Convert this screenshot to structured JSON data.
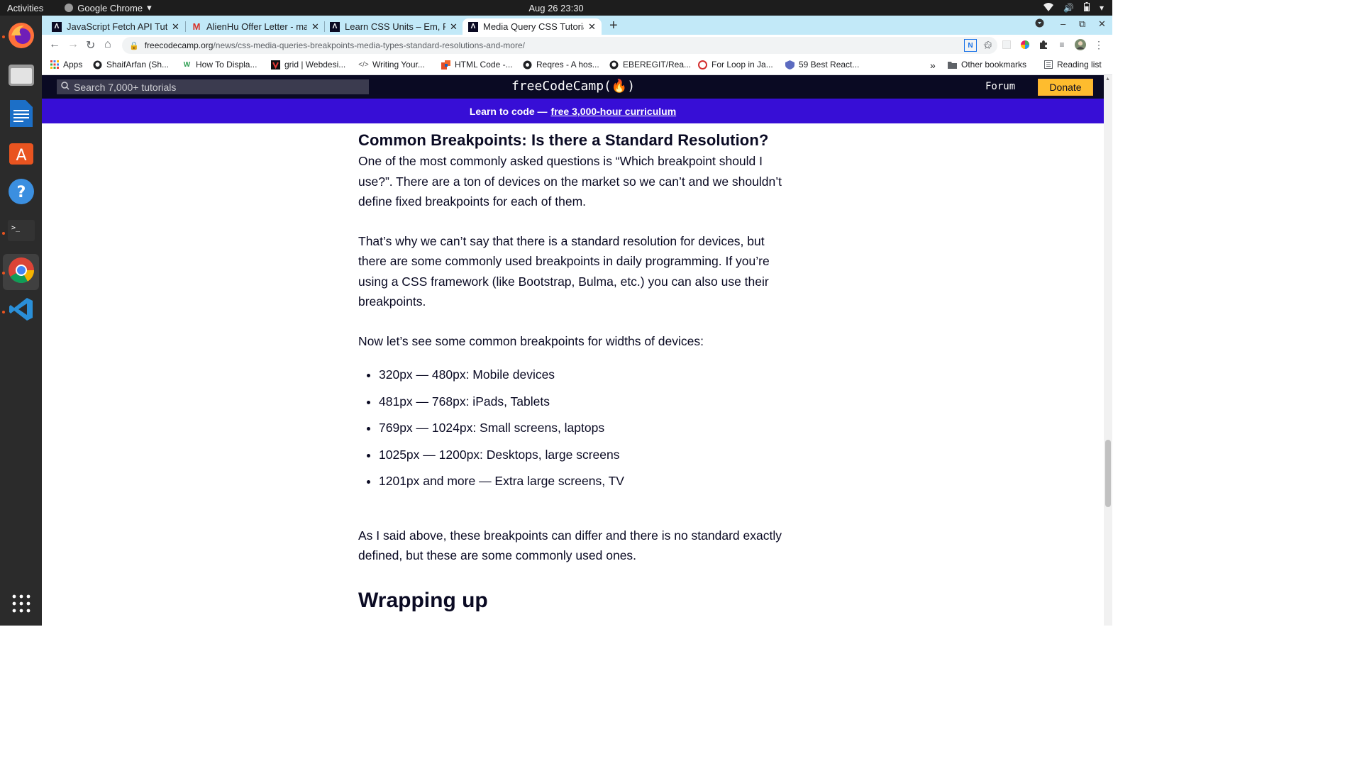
{
  "system": {
    "activities": "Activities",
    "app_name": "Google Chrome",
    "clock": "Aug 26  23:30"
  },
  "tabs": [
    {
      "title": "JavaScript Fetch API Tuto",
      "favicon": "freecodecamp-icon"
    },
    {
      "title": "AlienHu Offer Letter - ma",
      "favicon": "gmail-icon"
    },
    {
      "title": "Learn CSS Units – Em, Rem",
      "favicon": "freecodecamp-icon"
    },
    {
      "title": "Media Query CSS Tutorial",
      "favicon": "freecodecamp-icon",
      "active": true
    }
  ],
  "address": {
    "domain": "freecodecamp.org",
    "path": "/news/css-media-queries-breakpoints-media-types-standard-resolutions-and-more/"
  },
  "bookmarks": [
    {
      "label": "Apps"
    },
    {
      "label": "ShaifArfan (Sh..."
    },
    {
      "label": "How To Displa..."
    },
    {
      "label": "grid | Webdesi..."
    },
    {
      "label": "Writing Your..."
    },
    {
      "label": "HTML Code -..."
    },
    {
      "label": "Reqres - A hos..."
    },
    {
      "label": "EBEREGIT/Rea..."
    },
    {
      "label": "For Loop in Ja..."
    },
    {
      "label": "59 Best React..."
    }
  ],
  "bookmarks_overflow": "»",
  "other_bookmarks": "Other bookmarks",
  "reading_list": "Reading list",
  "fcc": {
    "search_placeholder": "Search 7,000+ tutorials",
    "logo": "freeCodeCamp(🔥)",
    "forum": "Forum",
    "donate": "Donate",
    "banner_text": "Learn to code —",
    "banner_link": "free 3,000-hour curriculum"
  },
  "article": {
    "heading": "Common Breakpoints: Is there a Standard Resolution?",
    "p1": "One of the most commonly asked questions is “Which breakpoint should I use?”. There are a ton of devices on the market so we can’t and we shouldn’t define fixed breakpoints for each of them.",
    "p2": "That’s why we can’t say that there is a standard resolution for devices, but there are some commonly used breakpoints in daily programming. If you’re using a CSS framework (like Bootstrap, Bulma, etc.) you can also use their breakpoints.",
    "p3": "Now let’s see some common breakpoints for widths of devices:",
    "list": [
      "320px — 480px: Mobile devices",
      "481px — 768px: iPads, Tablets",
      "769px — 1024px: Small screens, laptops",
      "1025px — 1200px: Desktops, large screens",
      "1201px and more —  Extra large screens, TV"
    ],
    "p4": "As I said above, these breakpoints can differ and there is no standard exactly defined, but these are some commonly used ones.",
    "heading2": "Wrapping up"
  },
  "colors": {
    "fcc_nav": "#0a0a23",
    "banner": "#370ed6",
    "donate": "#febc2e",
    "tabstrip": "#c2e9f8"
  }
}
